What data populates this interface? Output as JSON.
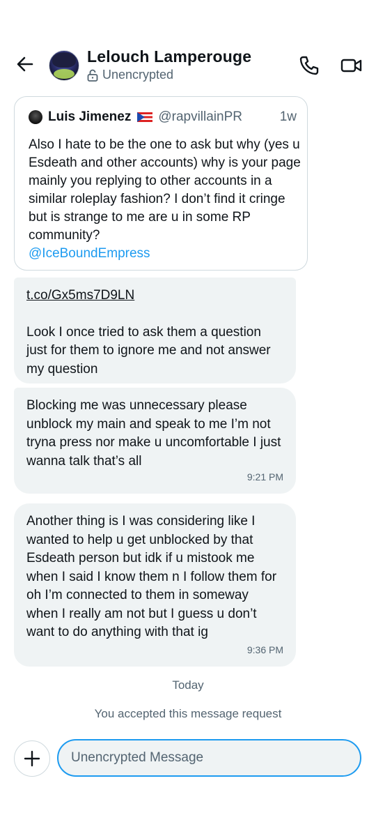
{
  "header": {
    "contact_name": "Lelouch Lamperouge",
    "encryption_status": "Unencrypted"
  },
  "quote": {
    "author_name": "Luis Jimenez",
    "author_handle": "@rapvillainPR",
    "time": "1w",
    "text": "Also I hate to be the one to ask but why (yes u Esdeath and other accounts) why is your page mainly you replying to other accounts in a similar roleplay fashion? I don’t find it cringe but is strange to me are u in some RP community?",
    "mention": "@IceBoundEmpress"
  },
  "messages": [
    {
      "link": "t.co/Gx5ms7D9LN",
      "text": "Look I once tried to ask them a question just for them to ignore me and not answer my question",
      "time": ""
    },
    {
      "text": "Blocking me was unnecessary please unblock my main and speak to me I’m not tryna press nor make u uncomfortable I just wanna talk that’s all",
      "time": "9:21 PM"
    },
    {
      "text": "Another thing is I was considering like I wanted to help u get unblocked by that Esdeath person but idk if u mistook me when I said I know them n I follow them for oh I’m connected to them in someway when I really am not but I guess u don’t want to do anything with that ig",
      "time": "9:36 PM"
    }
  ],
  "day_separator": "Today",
  "system_message": "You accepted this message request",
  "composer": {
    "placeholder": "Unencrypted Message"
  },
  "icons": {
    "back": "arrow-left-icon",
    "lock": "unlocked-padlock-icon",
    "call": "phone-icon",
    "video": "video-camera-icon",
    "add": "plus-icon"
  },
  "colors": {
    "accent": "#1d9bf0",
    "bubble": "#eff3f4",
    "secondary_text": "#536471"
  }
}
